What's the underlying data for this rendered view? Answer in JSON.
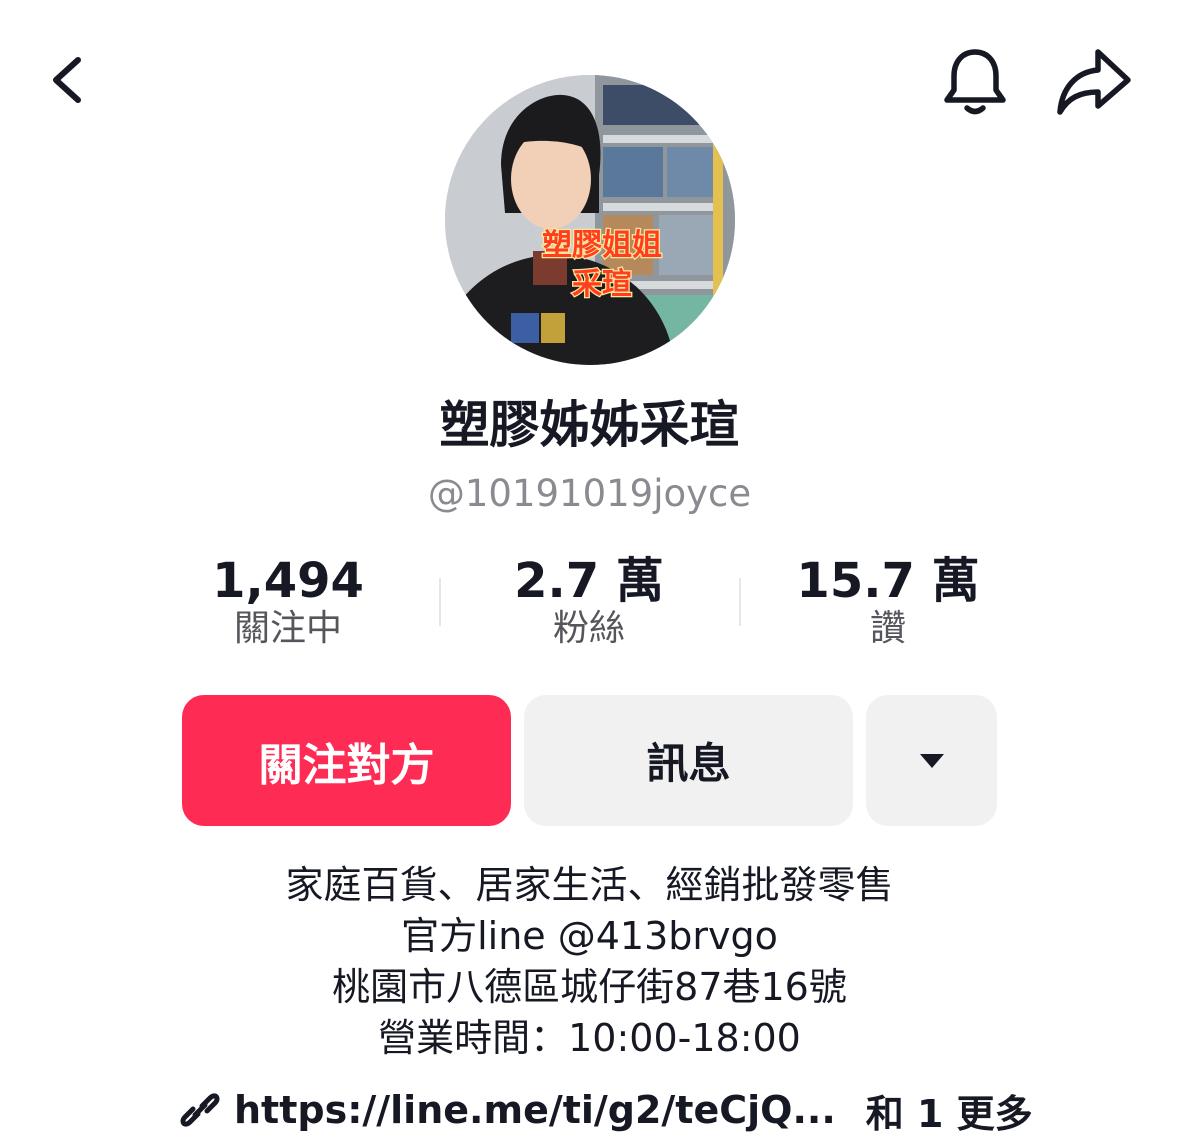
{
  "profile": {
    "display_name": "塑膠姊姊采瑄",
    "username": "@10191019joyce",
    "avatar_caption_line1": "塑膠姐姐",
    "avatar_caption_line2": "采瑄"
  },
  "stats": {
    "following": {
      "value": "1,494",
      "label": "關注中"
    },
    "followers": {
      "value": "2.7 萬",
      "label": "粉絲"
    },
    "likes": {
      "value": "15.7 萬",
      "label": "讚"
    }
  },
  "actions": {
    "follow_label": "關注對方",
    "message_label": "訊息",
    "more_icon": "caret-down-icon"
  },
  "bio": {
    "lines": [
      "家庭百貨、居家生活、經銷批發零售",
      "官方line @413brvgo",
      "桃園市八德區城仔街87巷16號",
      "營業時間：10:00-18:00"
    ]
  },
  "link": {
    "icon": "link-icon",
    "text": "https://line.me/ti/g2/teCjQ...",
    "more": "和 1 更多"
  },
  "header_icons": {
    "back": "chevron-left-icon",
    "notifications": "bell-icon",
    "share": "share-arrow-icon"
  },
  "colors": {
    "primary": "#fe2c55",
    "button_gray": "#f1f1f2",
    "text": "#161823",
    "secondary_text": "#8a8b91"
  }
}
